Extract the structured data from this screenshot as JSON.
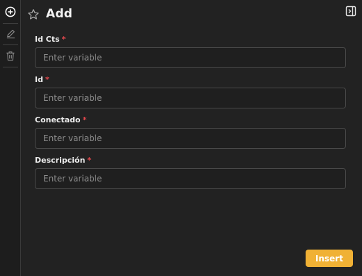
{
  "header": {
    "title": "Add",
    "star_icon": "star-icon",
    "panel_icon": "panel-toggle-icon"
  },
  "toolbar": {
    "items": [
      {
        "icon": "plus-circle-icon",
        "active": true
      },
      {
        "icon": "edit-icon",
        "active": false
      },
      {
        "icon": "trash-icon",
        "active": false
      }
    ]
  },
  "form": {
    "fields": [
      {
        "label": "Id Cts",
        "required_mark": "*",
        "placeholder": "Enter variable",
        "value": ""
      },
      {
        "label": "Id",
        "required_mark": "*",
        "placeholder": "Enter variable",
        "value": ""
      },
      {
        "label": "Conectado",
        "required_mark": "*",
        "placeholder": "Enter variable",
        "value": ""
      },
      {
        "label": "Descripción",
        "required_mark": "*",
        "placeholder": "Enter variable",
        "value": ""
      }
    ],
    "submit_label": "Insert"
  },
  "colors": {
    "accent": "#f0b135",
    "required": "#e5484d",
    "background": "#222222"
  }
}
